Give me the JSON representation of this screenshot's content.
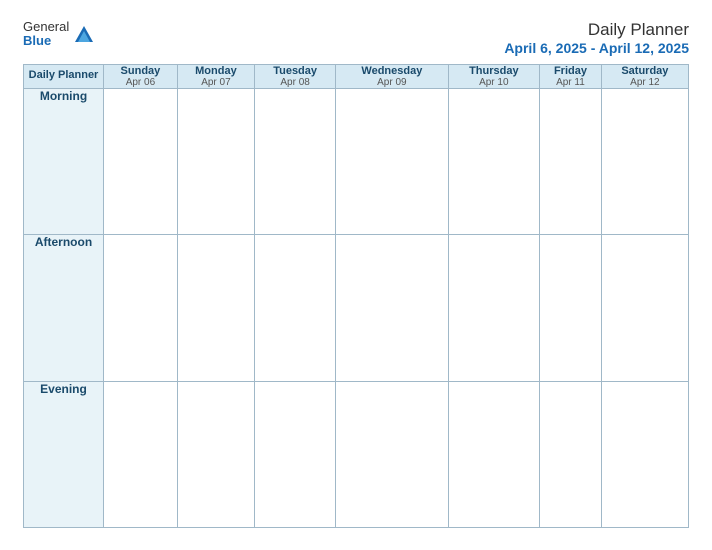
{
  "logo": {
    "general": "General",
    "blue": "Blue",
    "icon_color": "#1a6bb5"
  },
  "header": {
    "title": "Daily Planner",
    "date_range": "April 6, 2025 - April 12, 2025"
  },
  "table": {
    "label_header": "Daily Planner",
    "columns": [
      {
        "day": "Sunday",
        "date": "Apr 06"
      },
      {
        "day": "Monday",
        "date": "Apr 07"
      },
      {
        "day": "Tuesday",
        "date": "Apr 08"
      },
      {
        "day": "Wednesday",
        "date": "Apr 09"
      },
      {
        "day": "Thursday",
        "date": "Apr 10"
      },
      {
        "day": "Friday",
        "date": "Apr 11"
      },
      {
        "day": "Saturday",
        "date": "Apr 12"
      }
    ],
    "rows": [
      {
        "label": "Morning"
      },
      {
        "label": "Afternoon"
      },
      {
        "label": "Evening"
      }
    ]
  }
}
